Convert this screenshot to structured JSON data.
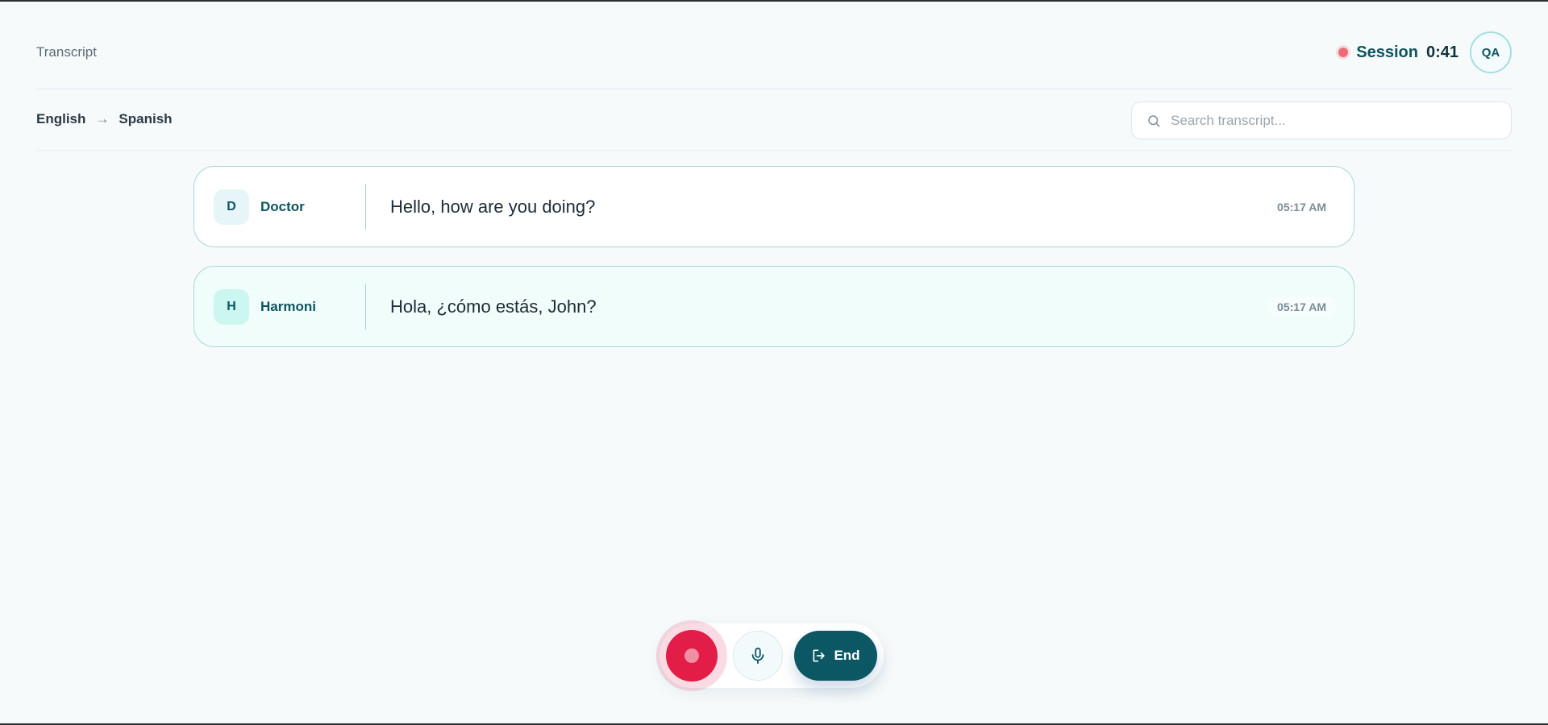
{
  "header": {
    "title": "Transcript",
    "session_label": "Session",
    "session_time": "0:41",
    "avatar_initials": "QA"
  },
  "languages": {
    "source": "English",
    "target": "Spanish",
    "arrow": "→"
  },
  "search": {
    "placeholder": "Search transcript..."
  },
  "messages": [
    {
      "initial": "D",
      "speaker": "Doctor",
      "text": "Hello, how are you doing?",
      "time": "05:17 AM"
    },
    {
      "initial": "H",
      "speaker": "Harmoni",
      "text": "Hola, ¿cómo estás, John?",
      "time": "05:17 AM"
    }
  ],
  "controls": {
    "end_label": "End"
  },
  "colors": {
    "brand": "#0b5763",
    "record": "#e11d48",
    "recording_indicator": "#f06a74"
  },
  "icons": {
    "search": "search-icon",
    "mic": "microphone-icon",
    "end": "exit-icon",
    "record": "record-icon"
  }
}
